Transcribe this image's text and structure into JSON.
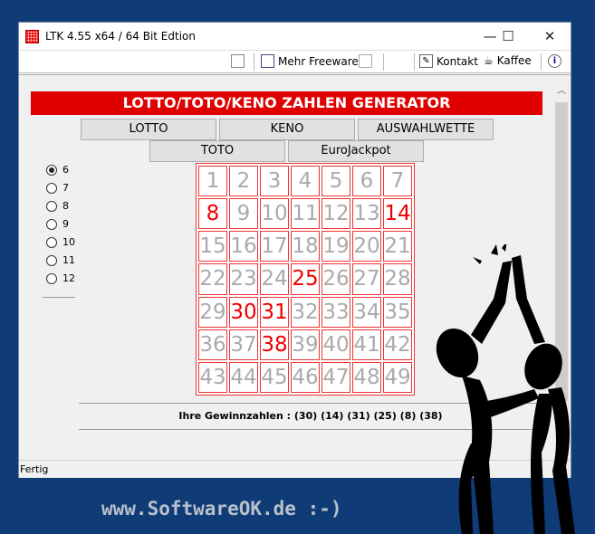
{
  "window": {
    "title": "LTK 4.55 x64 / 64 Bit Edtion",
    "minimize": "—",
    "maximize": "☐",
    "close": "✕"
  },
  "toolbar": {
    "more_freeware": "Mehr Freeware",
    "contact": "Kontakt",
    "coffee": "Kaffee",
    "info_icon": "i"
  },
  "banner": "LOTTO/TOTO/KENO ZAHLEN GENERATOR",
  "buttons": [
    "LOTTO",
    "KENO",
    "AUSWAHLWETTE",
    "TOTO",
    "EuroJackpot"
  ],
  "radios": [
    {
      "label": "6",
      "checked": true
    },
    {
      "label": "7"
    },
    {
      "label": "8"
    },
    {
      "label": "9"
    },
    {
      "label": "10"
    },
    {
      "label": "11"
    },
    {
      "label": "12"
    }
  ],
  "numbers": [
    1,
    2,
    3,
    4,
    5,
    6,
    7,
    8,
    9,
    10,
    11,
    12,
    13,
    14,
    15,
    16,
    17,
    18,
    19,
    20,
    21,
    22,
    23,
    24,
    25,
    26,
    27,
    28,
    29,
    30,
    31,
    32,
    33,
    34,
    35,
    36,
    37,
    38,
    39,
    40,
    41,
    42,
    43,
    44,
    45,
    46,
    47,
    48,
    49
  ],
  "selected": [
    8,
    14,
    25,
    30,
    31,
    38
  ],
  "result": "Ihre Gewinnzahlen : (30) (14) (31) (25) (8) (38)",
  "status": "Fertig",
  "footer": "www.SoftwareOK.de :-)",
  "colors": {
    "accent": "#e00000",
    "background": "#0f3c76"
  }
}
